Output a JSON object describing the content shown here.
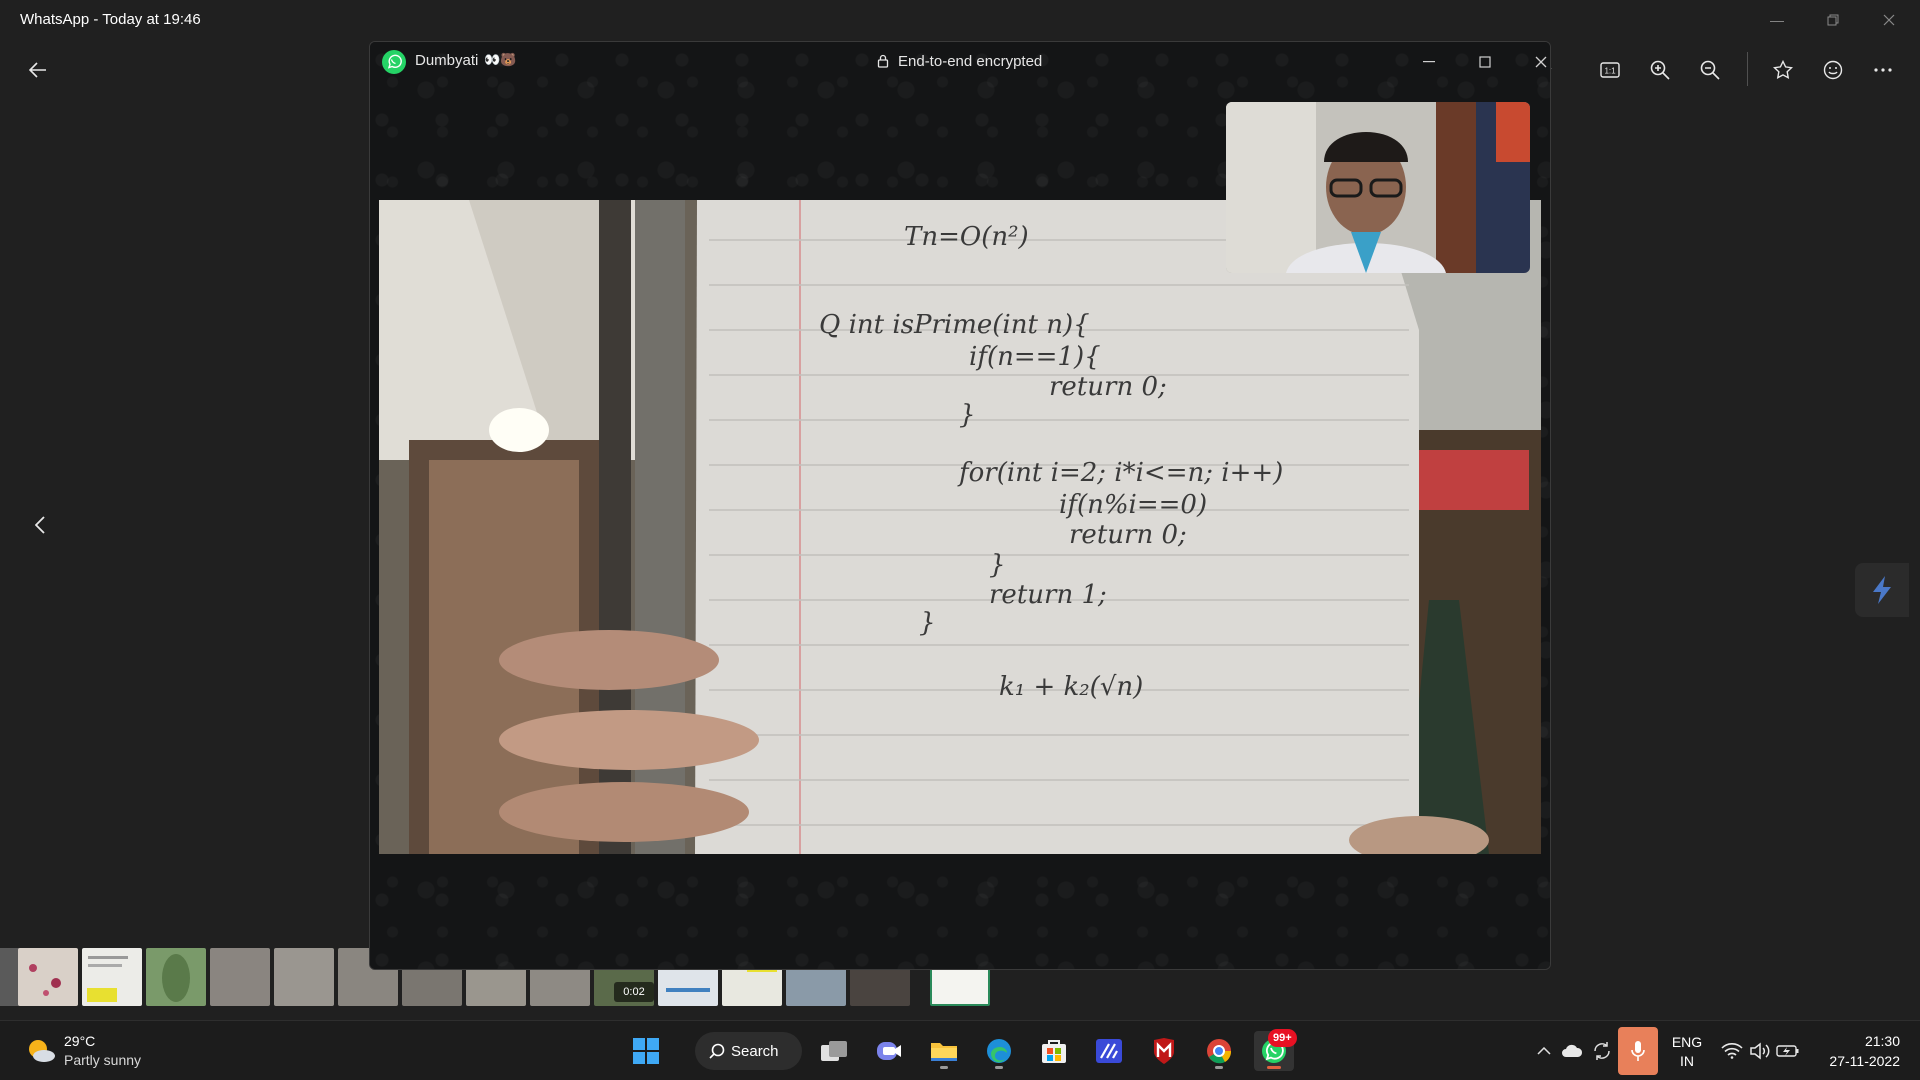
{
  "viewer": {
    "title": "WhatsApp - Today at 19:46",
    "thumb_time": "0:02",
    "toolbar": [
      "real-size-icon",
      "zoom-in-icon",
      "zoom-out-icon",
      "star-icon",
      "smiley-icon",
      "more-icon"
    ]
  },
  "call": {
    "contact": "Dumbyati",
    "contact_emojis": "👀🐻",
    "encrypted": "End-to-end encrypted",
    "note_lines": [
      "Tn=O(n²)",
      "Q int isPrime(int n){",
      "if(n==1){",
      "return 0;",
      "}",
      "for(int i=2; i*i<=n; i++)",
      "if(n%i==0)",
      "return 0;",
      "}",
      "return 1;",
      "}",
      "k₁ + k₂(√n)"
    ]
  },
  "taskbar": {
    "weather_temp": "29°C",
    "weather_desc": "Partly sunny",
    "search_label": "Search",
    "whatsapp_badge": "99+",
    "lang_line1": "ENG",
    "lang_line2": "IN",
    "time": "21:30",
    "date": "27-11-2022"
  }
}
